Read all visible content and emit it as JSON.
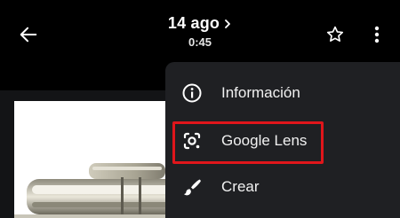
{
  "header": {
    "date": "14 ago",
    "time": "0:45"
  },
  "icons": {
    "back": "arrow-left-icon",
    "date_chevron": "chevron-right-icon",
    "favorite": "star-outline-icon",
    "more": "more-vertical-icon"
  },
  "menu": {
    "items": [
      {
        "label": "Información",
        "icon": "info-icon"
      },
      {
        "label": "Google Lens",
        "icon": "google-lens-icon",
        "highlighted": true
      },
      {
        "label": "Crear",
        "icon": "brush-icon"
      }
    ]
  },
  "colors": {
    "background": "#000000",
    "menu_background": "#1f2023",
    "highlight_outline": "#e0161b",
    "text": "#ffffff"
  }
}
